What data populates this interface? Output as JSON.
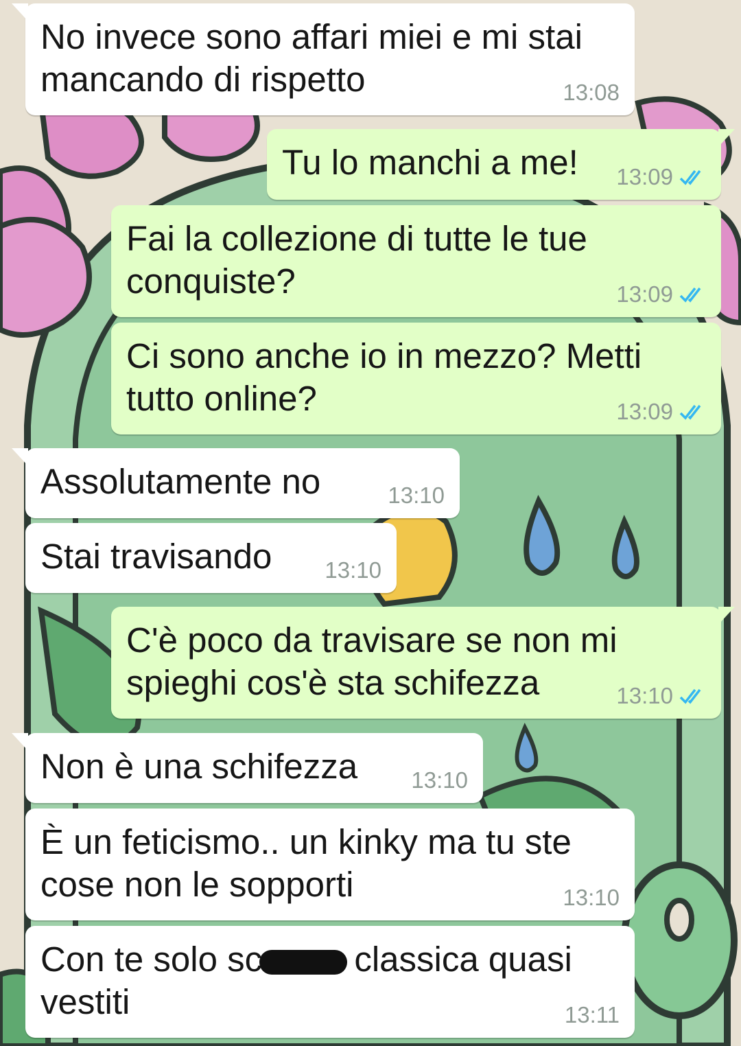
{
  "messages": [
    {
      "direction": "in",
      "line1": "No invece sono affari miei e mi stai",
      "line2": "mancando di rispetto",
      "time": "13:08",
      "tail": true
    },
    {
      "direction": "out",
      "line1": "Tu lo manchi a me!",
      "time": "13:09",
      "tail": true,
      "read": true
    },
    {
      "direction": "out",
      "line1": "Fai la collezione di tutte le tue",
      "line2": "conquiste?",
      "time": "13:09",
      "read": true
    },
    {
      "direction": "out",
      "line1": "Ci sono anche io in mezzo? Metti",
      "line2": "tutto online?",
      "time": "13:09",
      "read": true
    },
    {
      "direction": "in",
      "line1": "Assolutamente no",
      "time": "13:10",
      "tail": true
    },
    {
      "direction": "in",
      "line1": "Stai travisando",
      "time": "13:10"
    },
    {
      "direction": "out",
      "line1": "C'è poco da travisare se non mi",
      "line2": "spieghi cos'è sta schifezza",
      "time": "13:10",
      "tail": true,
      "read": true
    },
    {
      "direction": "in",
      "line1": "Non è una schifezza",
      "time": "13:10",
      "tail": true
    },
    {
      "direction": "in",
      "line1": "È un feticismo.. un kinky ma tu ste",
      "line2": "cose non le sopporti",
      "time": "13:10"
    },
    {
      "direction": "in",
      "line1_before": "Con te solo sc",
      "line1_after": "classica quasi",
      "line2": "vestiti",
      "time": "13:11",
      "redacted": true
    }
  ],
  "colors": {
    "incoming_bubble": "#ffffff",
    "outgoing_bubble": "#e2ffc7",
    "read_ticks": "#34b7f1",
    "timestamp": "#8f9a94"
  }
}
